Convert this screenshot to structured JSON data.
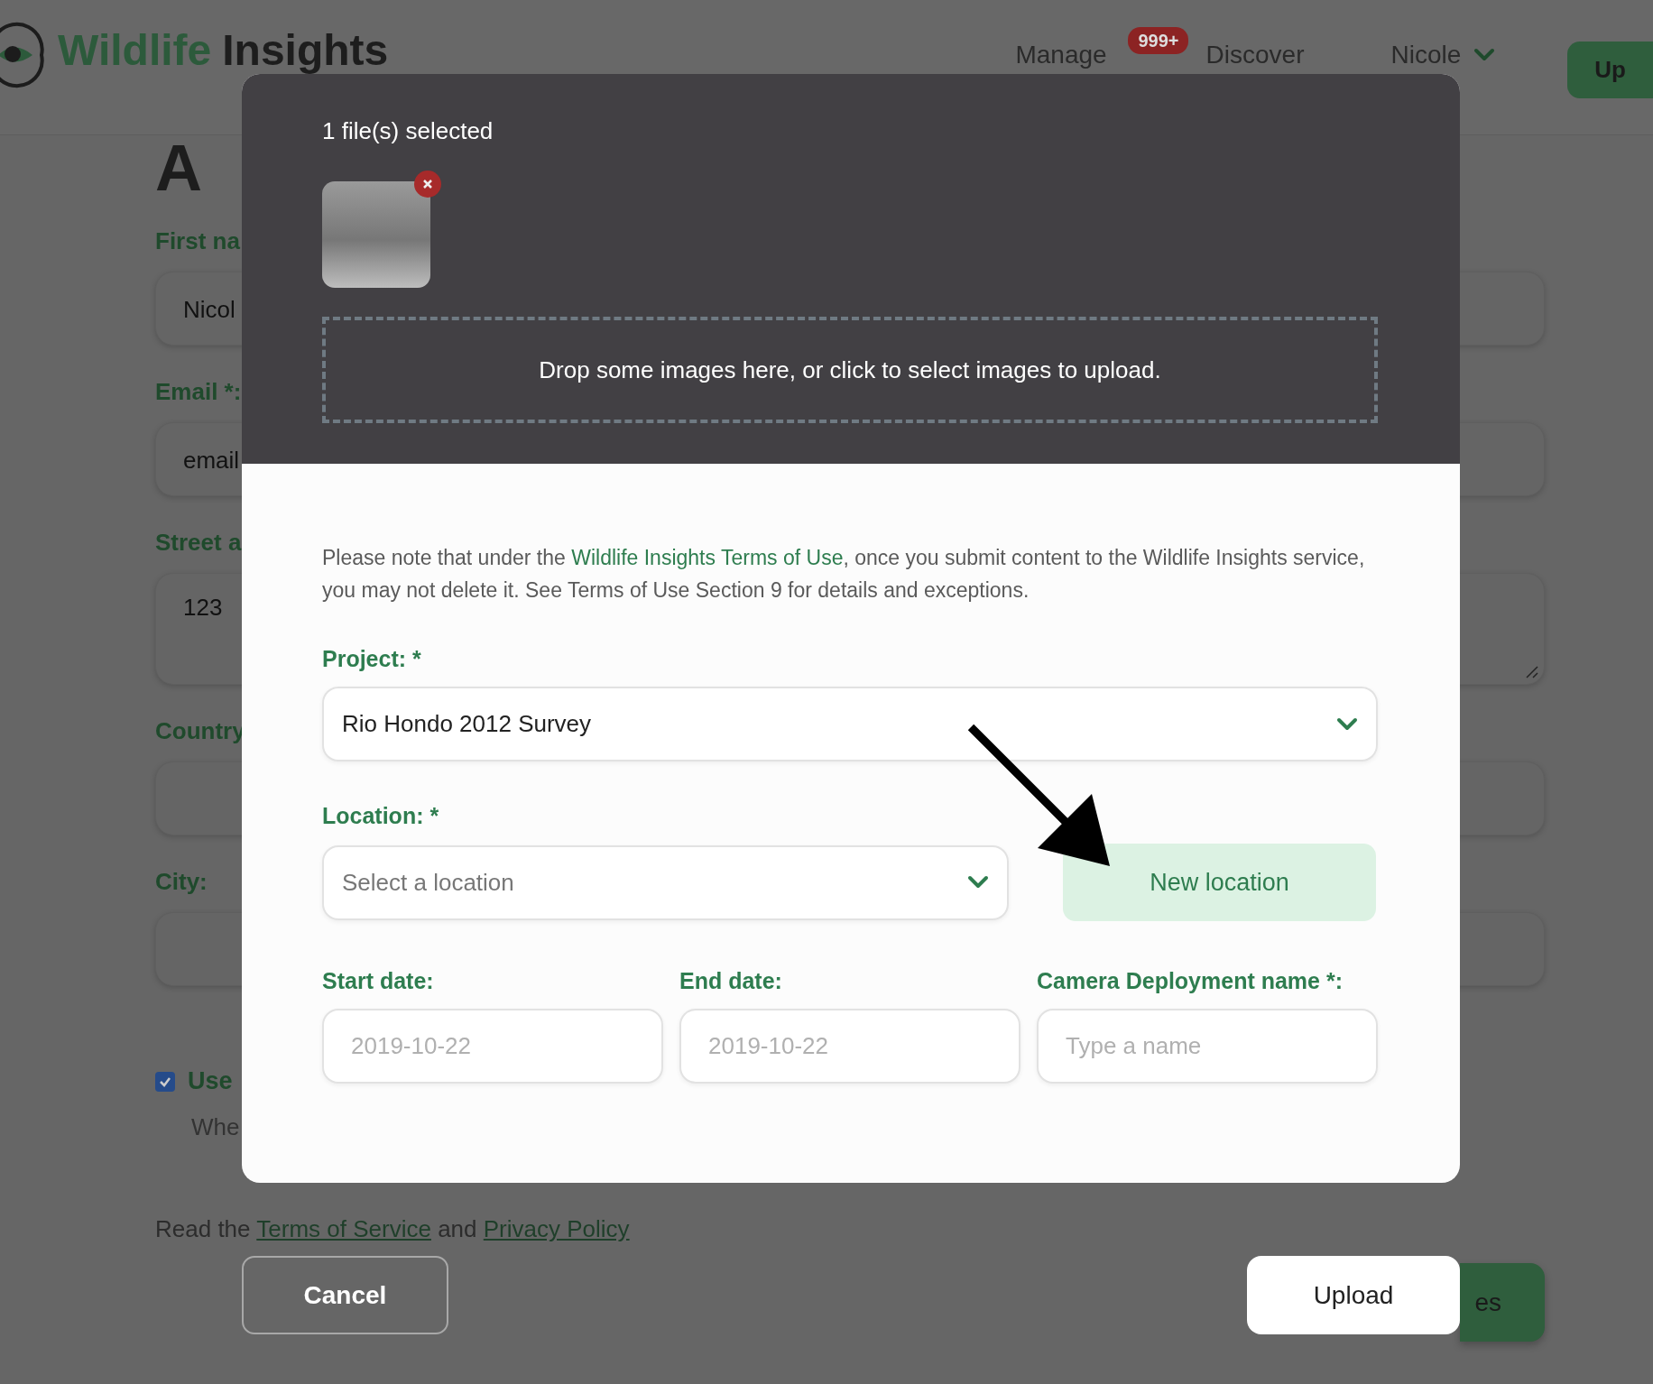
{
  "header": {
    "logo_words": [
      "Wildlife",
      "Insights"
    ],
    "nav": [
      {
        "label": "Manage",
        "badge": "999+"
      },
      {
        "label": "Discover"
      }
    ],
    "user": "Nicole",
    "button": "Up"
  },
  "background_form": {
    "heading": "A",
    "fields": [
      {
        "kind": "input",
        "label": "First na",
        "value": "Nicol"
      },
      {
        "kind": "input",
        "label": "Email *:",
        "value": "email"
      },
      {
        "kind": "textarea",
        "label": "Street a",
        "value": "123"
      },
      {
        "kind": "input",
        "label": "Country"
      },
      {
        "kind": "input",
        "label": "City:"
      }
    ],
    "checkbox": {
      "label": "Use",
      "checked": true,
      "hint": "Whe"
    },
    "terms": {
      "prefix": "Read the",
      "link_1": "Terms of Service",
      "middle": "and",
      "link_2": "Privacy Policy"
    },
    "save_button": "es"
  },
  "modal": {
    "files_selected": "1 file(s) selected",
    "dropzone": "Drop some images here, or click to select images to upload.",
    "notice": {
      "before": "Please note that under the",
      "link": "Wildlife Insights Terms of Use",
      "after": ", once you submit content to the Wildlife Insights service, you may not delete it. See Terms of Use Section 9 for details and exceptions."
    },
    "project": {
      "label": "Project: *",
      "value": "Rio Hondo 2012 Survey"
    },
    "location": {
      "label": "Location: *",
      "placeholder": "Select a location"
    },
    "new_location_button": "New location",
    "fields": [
      {
        "label": "Start date:",
        "placeholder": "2019-10-22"
      },
      {
        "label": "End date:",
        "placeholder": "2019-10-22"
      },
      {
        "label": "Camera Deployment name *:",
        "placeholder": "Type a name"
      }
    ],
    "cancel_button": "Cancel",
    "upload_button": "Upload"
  }
}
